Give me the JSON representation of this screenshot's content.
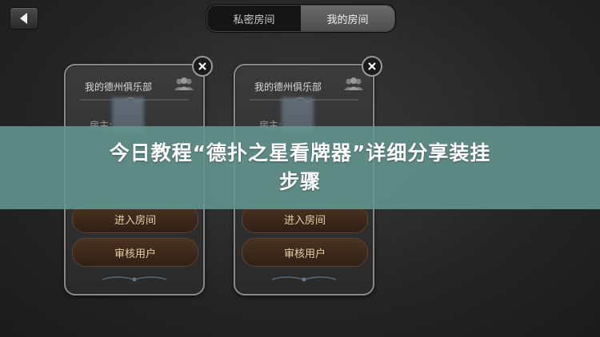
{
  "tabs": [
    {
      "label": "私密房间",
      "active": false
    },
    {
      "label": "我的房间",
      "active": true
    }
  ],
  "cards": [
    {
      "title": "我的德州俱乐部",
      "owner_label": "房主:",
      "enter_label": "进入房间",
      "review_label": "审核用户"
    },
    {
      "title": "我的德州俱乐部",
      "owner_label": "房主:",
      "enter_label": "进入房间",
      "review_label": "审核用户"
    }
  ],
  "banner": {
    "line1": "今日教程“德扑之星看牌器”详细分享装挂",
    "line2": "步骤"
  },
  "colors": {
    "banner_bg": "#64968f",
    "button_text": "#e7cfa9",
    "active_tab": "#5a5a5a"
  },
  "icons": [
    "back-arrow-icon",
    "close-icon",
    "group-icon"
  ]
}
